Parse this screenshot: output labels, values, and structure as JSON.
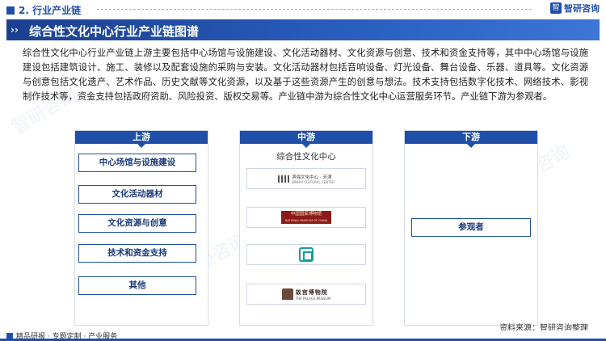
{
  "header": {
    "section_label": "2. 行业产业链",
    "brand": "智研咨询",
    "title": "综合性文化中心行业产业链图谱"
  },
  "intro": "综合性文化中心行业产业链上游主要包括中心场馆与设施建设、文化活动器材、文化资源与创意、技术和资金支持等，其中中心场馆与设施建设包括建筑设计、施工、装修以及配套设施的采购与安装。文化活动器材包括音响设备、灯光设备、舞台设备、乐器、道具等。文化资源与创意包括文化遗产、艺术作品、历史文献等文化资源，以及基于这些资源产生的创意与想法。技术支持包括数字化技术、网络技术、影视制作技术等，资金支持包括政府资助、风险投资、版权交易等。产业链中游为综合性文化中心运营服务环节。产业链下游为参观者。",
  "upstream": {
    "label": "上游",
    "items": [
      "中心场馆与设施建设",
      "文化活动器材",
      "文化资源与创意",
      "技术和资金支持",
      "其他"
    ]
  },
  "midstream": {
    "label": "中游",
    "title": "综合性文化中心",
    "logos": [
      {
        "icon": "tianjin-culture-center-logo",
        "text": "滨海文化中心 · 天津",
        "sub": "BINHAI CULTURAL CENTER"
      },
      {
        "icon": "national-museum-logo",
        "text": "中国国家博物馆",
        "sub": "NATIONAL MUSEUM OF CHINA"
      },
      {
        "icon": "knot-logo"
      },
      {
        "icon": "palace-museum-logo",
        "text": "故宫博物院",
        "sub": "THE PALACE MUSEUM"
      }
    ]
  },
  "downstream": {
    "label": "下游",
    "items": [
      "参观者"
    ]
  },
  "source": "资料来源：智研咨询整理",
  "footer": "精品研报 · 专题定制 · 产业服务",
  "colors": {
    "primary": "#1f4fa8",
    "title_bar": "#2a5fc0"
  }
}
